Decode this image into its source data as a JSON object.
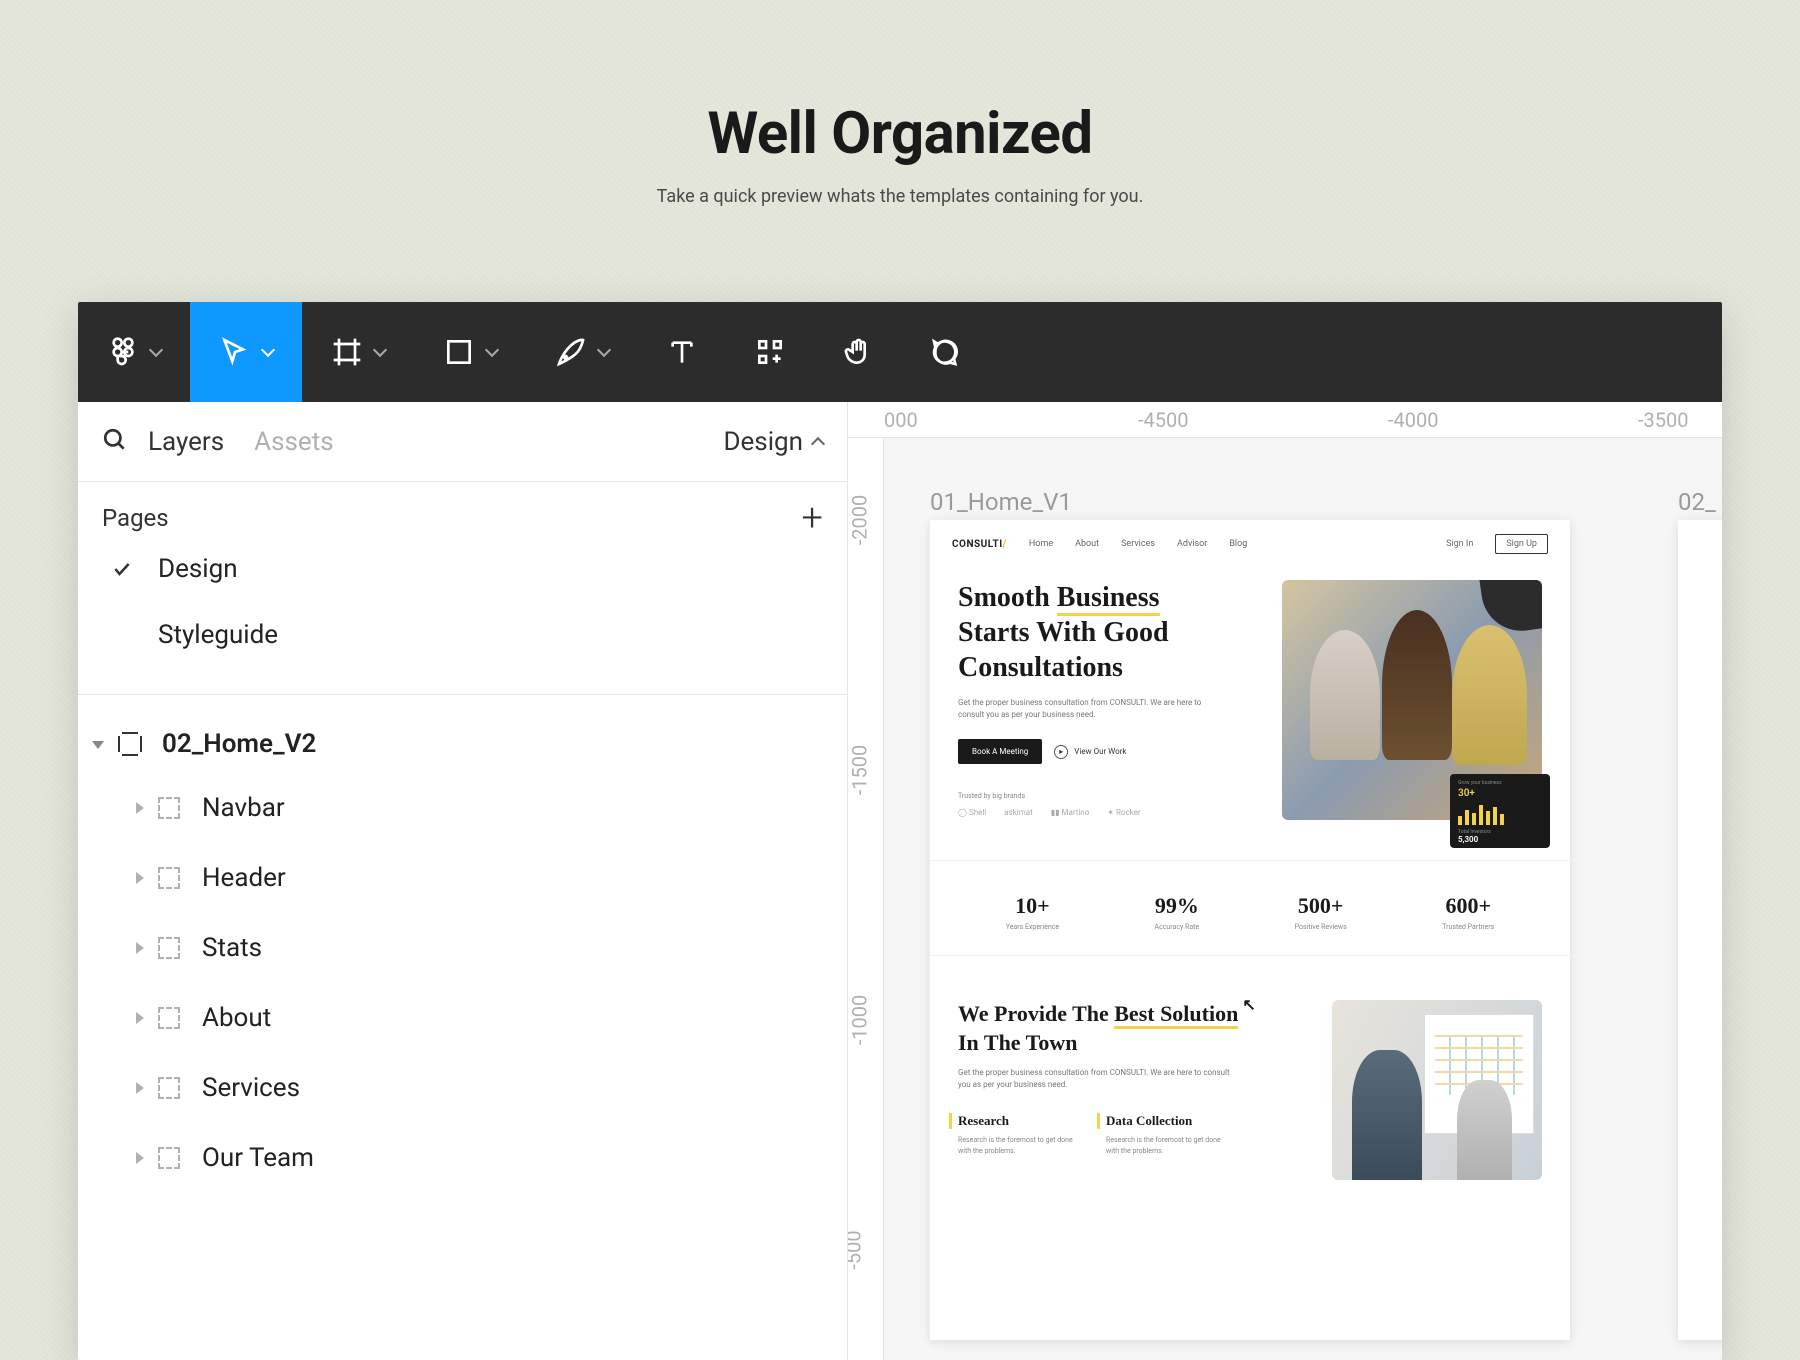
{
  "header": {
    "title": "Well Organized",
    "subtitle": "Take a quick preview whats the templates containing for you."
  },
  "toolbar": {
    "tools": [
      "figma-menu",
      "move",
      "frame",
      "rectangle",
      "pen",
      "text",
      "plugins",
      "hand",
      "comment"
    ]
  },
  "leftPanel": {
    "tabs": {
      "layers": "Layers",
      "assets": "Assets",
      "right": "Design"
    },
    "pagesLabel": "Pages",
    "pages": [
      {
        "name": "Design",
        "active": true
      },
      {
        "name": "Styleguide",
        "active": false
      }
    ],
    "rootLayer": "02_Home_V2",
    "layers": [
      "Navbar",
      "Header",
      "Stats",
      "About",
      "Services",
      "Our Team"
    ]
  },
  "canvas": {
    "hRuler": [
      "000",
      "-4500",
      "-4000",
      "-3500"
    ],
    "vRuler": [
      "-2000",
      "-1500",
      "-1000",
      "-500"
    ],
    "frameLabels": {
      "a": "01_Home_V1",
      "b": "02_"
    }
  },
  "artboard": {
    "nav": {
      "logo": "CONSULTI",
      "items": [
        "Home",
        "About",
        "Services",
        "Advisor",
        "Blog"
      ],
      "signin": "Sign In",
      "signup": "Sign Up"
    },
    "hero": {
      "line1": "Smooth",
      "line1u": "Business",
      "line2": "Starts With Good",
      "line3": "Consultations",
      "desc": "Get the proper business consultation from CONSULTI. We are here to consult you as per your business need.",
      "cta": "Book A Meeting",
      "play": "View Our Work",
      "trusted": "Trusted by big brands",
      "brands": [
        "Shell",
        "askimat",
        "Martino",
        "Rocker"
      ]
    },
    "statcard": {
      "t1": "Grow your business",
      "v1": "30+",
      "t2": "Total Investors",
      "v2": "5,300"
    },
    "stats": [
      {
        "num": "10+",
        "lbl": "Years Experience"
      },
      {
        "num": "99%",
        "lbl": "Accuracy Rate"
      },
      {
        "num": "500+",
        "lbl": "Positive Reviews"
      },
      {
        "num": "600+",
        "lbl": "Trusted Partners"
      }
    ],
    "section2": {
      "h_a": "We Provide The",
      "h_b": "Best Solution",
      "h_c": "In The Town",
      "desc": "Get the proper business consultation from CONSULTI. We are here to consult you as per your business need.",
      "col1": {
        "h": "Research",
        "p": "Research is the foremost to get done with the problems."
      },
      "col2": {
        "h": "Data Collection",
        "p": "Research is the foremost to get done with the problems."
      }
    }
  }
}
